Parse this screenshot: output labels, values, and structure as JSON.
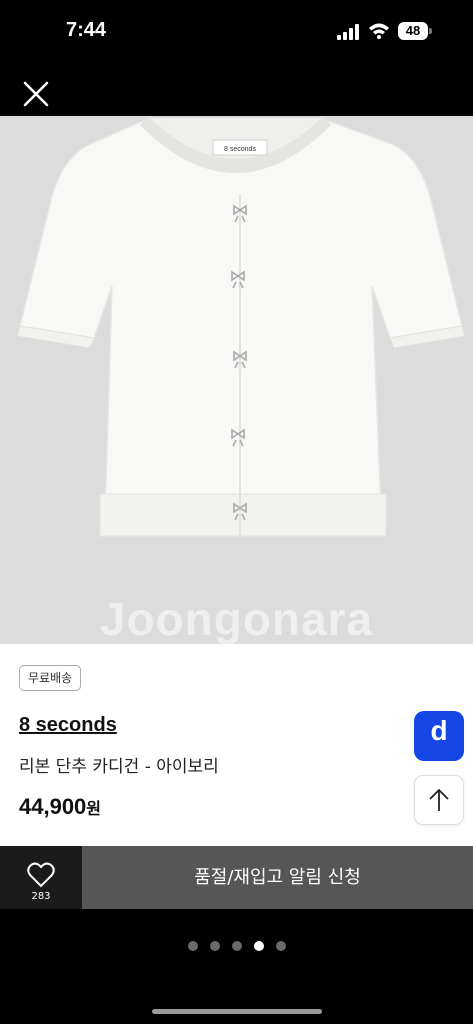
{
  "status_bar": {
    "time": "7:44",
    "battery": "48"
  },
  "image": {
    "watermark": "Joongonara",
    "label_text": "8 seconds",
    "progress_fraction": 0.55
  },
  "product": {
    "badge": "무료배송",
    "brand": "8 seconds",
    "name": "리본 단추 카디건 - 아이보리",
    "price": "44,900",
    "price_unit": "원"
  },
  "side_buttons": {
    "d_label": "d"
  },
  "bottom": {
    "like_count": "283",
    "restock_label": "품절/재입고 알림 신청"
  },
  "pager": {
    "count": 5,
    "active_index": 3
  },
  "icons": [
    "close-icon",
    "heart-icon",
    "arrow-up-icon",
    "signal-icon",
    "wifi-icon",
    "battery-icon"
  ],
  "colors": {
    "accent": "#1447e6",
    "button_gray": "#565656"
  }
}
